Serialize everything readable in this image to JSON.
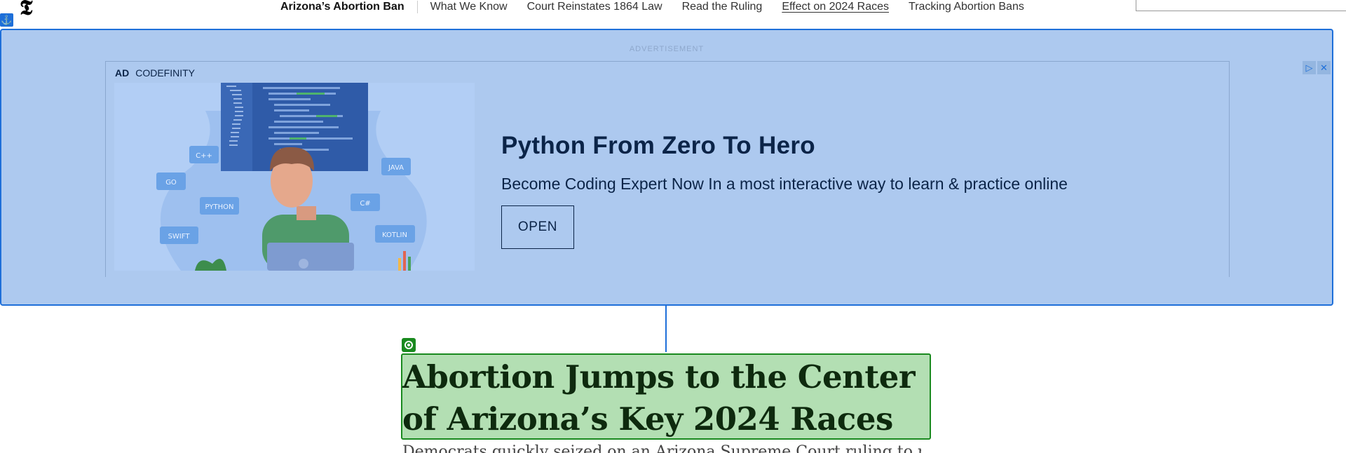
{
  "header": {
    "logo": "𝕿",
    "section_title": "Arizona’s Abortion Ban",
    "nav_items": [
      {
        "label": "What We Know"
      },
      {
        "label": "Court Reinstates 1864 Law"
      },
      {
        "label": "Read the Ruling"
      },
      {
        "label": "Effect on 2024 Races"
      },
      {
        "label": "Tracking Abortion Bans"
      }
    ]
  },
  "ad": {
    "label": "ADVERTISEMENT",
    "tag": "AD",
    "sponsor": "CODEFINITY",
    "title": "Python From Zero To Hero",
    "subtitle": "Become Coding Expert Now In a most interactive way to learn & practice online",
    "cta": "OPEN",
    "illustration_tags": [
      "C++",
      "GO",
      "PYTHON",
      "SWIFT",
      "JAVA",
      "C#",
      "KOTLIN"
    ]
  },
  "article": {
    "headline": "Abortion Jumps to the Center of Arizona’s Key 2024 Races",
    "summary": "Democrats quickly seized on an Arizona Supreme Court ruling to make the issue a centerpiece"
  },
  "colors": {
    "ad_overlay": "#adc9ef",
    "ad_border": "#1e6fd9",
    "headline_overlay": "#b3dfb3",
    "headline_border": "#1a8a1f"
  }
}
